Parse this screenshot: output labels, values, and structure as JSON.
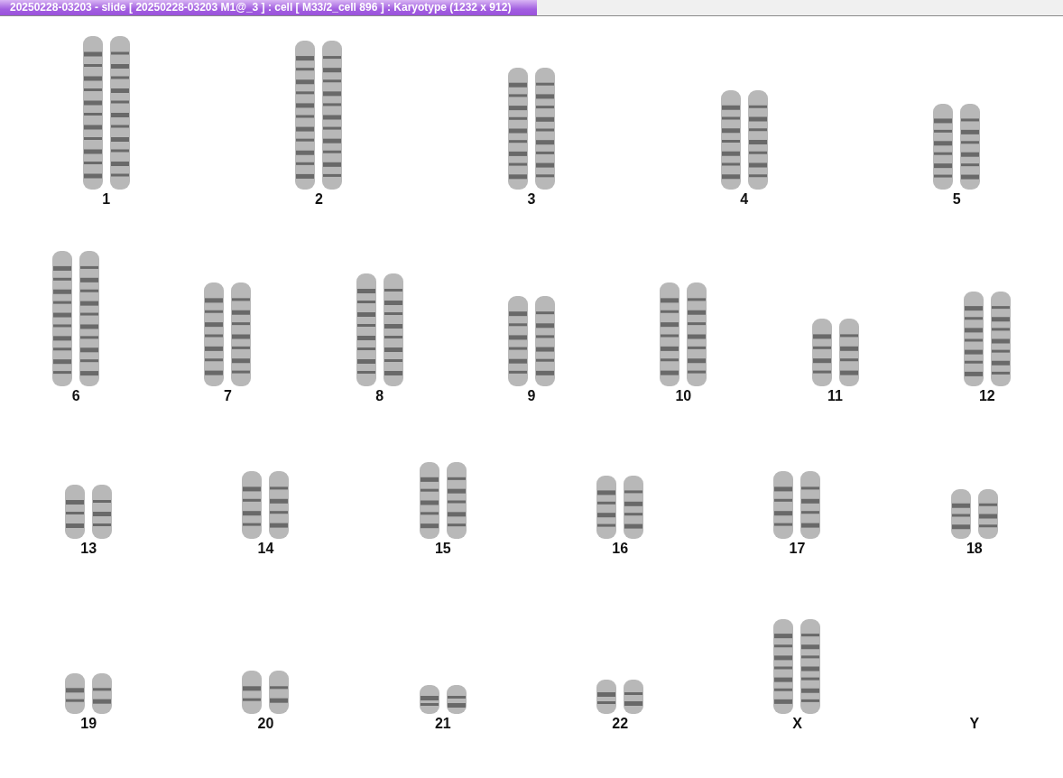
{
  "window": {
    "title": "20250228-03203 - slide [ 20250228-03203 M1@_3 ] : cell [ M33/2_cell 896 ] : Karyotype  (1232 x 912)"
  },
  "rows": [
    {
      "pairs": [
        {
          "label": "1",
          "kind": "pair"
        },
        {
          "label": "2",
          "kind": "pair"
        },
        {
          "label": "3",
          "kind": "pair"
        },
        {
          "label": "4",
          "kind": "pair"
        },
        {
          "label": "5",
          "kind": "pair"
        }
      ]
    },
    {
      "pairs": [
        {
          "label": "6",
          "kind": "pair"
        },
        {
          "label": "7",
          "kind": "pair"
        },
        {
          "label": "8",
          "kind": "pair"
        },
        {
          "label": "9",
          "kind": "pair"
        },
        {
          "label": "10",
          "kind": "pair"
        },
        {
          "label": "11",
          "kind": "pair"
        },
        {
          "label": "12",
          "kind": "pair"
        }
      ]
    },
    {
      "pairs": [
        {
          "label": "13",
          "kind": "pair"
        },
        {
          "label": "14",
          "kind": "pair"
        },
        {
          "label": "15",
          "kind": "pair"
        },
        {
          "label": "16",
          "kind": "pair"
        },
        {
          "label": "17",
          "kind": "pair"
        },
        {
          "label": "18",
          "kind": "pair"
        }
      ]
    },
    {
      "pairs": [
        {
          "label": "19",
          "kind": "pair"
        },
        {
          "label": "20",
          "kind": "pair"
        },
        {
          "label": "21",
          "kind": "pair"
        },
        {
          "label": "22",
          "kind": "pair"
        },
        {
          "label": "X",
          "kind": "pair"
        },
        {
          "label": "Y",
          "kind": "empty"
        }
      ]
    }
  ]
}
